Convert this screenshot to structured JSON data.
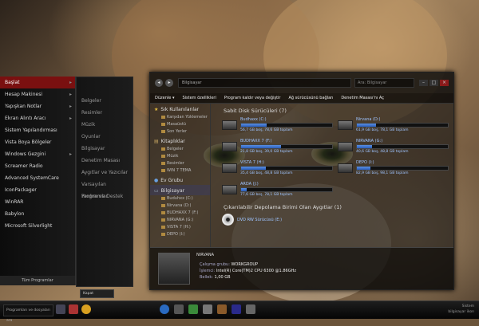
{
  "menu": {
    "items": [
      {
        "label": "Başlat",
        "arrow": "▸"
      },
      {
        "label": "Hesap Makinesi",
        "arrow": "▸"
      },
      {
        "label": "Yapışkan Notlar",
        "arrow": "▸"
      },
      {
        "label": "Ekran Alıntı Aracı",
        "arrow": "▸"
      },
      {
        "label": "Sistem Yapılandırması",
        "arrow": ""
      },
      {
        "label": "Vista Boya Bölgeler",
        "arrow": ""
      },
      {
        "label": "Windows Gezgini",
        "arrow": "▸"
      },
      {
        "label": "Screamer Radio",
        "arrow": ""
      },
      {
        "label": "Advanced SystemCare",
        "arrow": ""
      },
      {
        "label": "IconPackager",
        "arrow": ""
      },
      {
        "label": "WinRAR",
        "arrow": ""
      },
      {
        "label": "Babylon",
        "arrow": ""
      },
      {
        "label": "Microsoft Silverlight",
        "arrow": ""
      }
    ],
    "footer": "Tüm Programlar",
    "selected_index": 0
  },
  "menu2": {
    "items": [
      "Belgeler",
      "Resimler",
      "Müzik",
      "Oyunlar",
      "Bilgisayar",
      "Denetim Masası",
      "Aygıtlar ve Yazıcılar",
      "Varsayılan Programlar",
      "Yardım ve Destek"
    ]
  },
  "window": {
    "address": "Bilgisayar",
    "search_placeholder": "Ara: Bilgisayar",
    "toolbar": [
      "Düzenle ▾",
      "Sistem özellikleri",
      "Program kaldır veya değiştir",
      "Ağ sürücüsünü bağlan",
      "Denetim Masası'nı Aç"
    ],
    "nav": {
      "favorites_title": "Sık Kullanılanlar",
      "favorites": [
        "Karşıdan Yüklemeler",
        "Masaüstü",
        "Son Yerler"
      ],
      "libraries_title": "Kitaplıklar",
      "libraries": [
        "Belgeler",
        "Müzik",
        "Resimler",
        "WIN 7 TEMA"
      ],
      "homegroup": "Ev Grubu",
      "computer_title": "Bilgisayar",
      "computer": [
        "Buduhxx (C:)",
        "Nirvana (D:)",
        "BUDHAXX 7 (F:)",
        "NIRVANA (G:)",
        "VISTA 7 (H:)",
        "DEPO (I:)"
      ]
    },
    "hdd_section": "Sabit Disk Sürücüleri (7)",
    "drives": [
      {
        "name": "Budhaxx (C:)",
        "free": "56,7 GB boş, 78,6 GB toplam",
        "used": 0.28
      },
      {
        "name": "Nirvana (D:)",
        "free": "61,9 GB boş, 78,1 GB toplam",
        "used": 0.21
      },
      {
        "name": "BUDHAXX 7 (F:)",
        "free": "21,8 GB boş, 39,0 GB toplam",
        "used": 0.44
      },
      {
        "name": "NIRVANA (G:)",
        "free": "40,6 GB boş, 48,8 GB toplam",
        "used": 0.17
      },
      {
        "name": "VISTA 7 (H:)",
        "free": "35,4 GB boş, 48,8 GB toplam",
        "used": 0.27
      },
      {
        "name": "DEPO (I:)",
        "free": "82,9 GB boş, 98,1 GB toplam",
        "used": 0.15
      },
      {
        "name": "ARDA (J:)",
        "free": "77,6 GB boş, 78,1 GB toplam",
        "used": 0.06
      }
    ],
    "removable_section": "Çıkarılabilir Depolama Birimi Olan Aygıtlar (1)",
    "dvd": "DVD RW Sürücüsü (E:)",
    "details": {
      "name": "NIRVANA",
      "workgroup_label": "Çalışma grubu:",
      "workgroup": "WORKGROUP",
      "cpu_label": "İşlemci:",
      "cpu": "Intel(R) Core(TM)2 CPU     6300 @1.86GHz",
      "mem_label": "Bellek:",
      "mem": "1,00 GB"
    }
  },
  "taskbar": {
    "search_placeholder": "Programları ve dosyaları ara",
    "small_field": "Kapat",
    "tray": [
      "Sistem",
      "bilgisayar ikon"
    ]
  }
}
